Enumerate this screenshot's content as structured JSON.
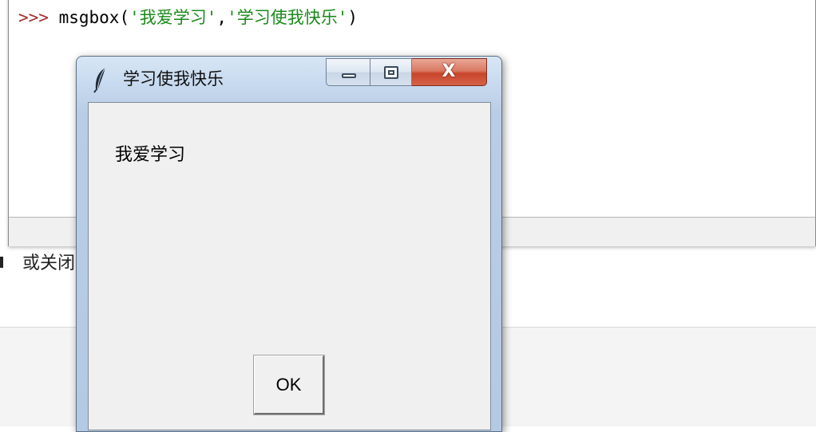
{
  "shell": {
    "prompt": ">>>",
    "function_name": "msgbox",
    "open_paren": "(",
    "arg1": "'我爱学习'",
    "comma": ",",
    "arg2": "'学习使我快乐'",
    "close_paren": ")",
    "partial_text": "或关闭"
  },
  "dialog": {
    "title": "学习使我快乐",
    "app_icon": "feather-icon",
    "minimize_icon": "minimize-icon",
    "maximize_icon": "maximize-icon",
    "close_icon": "close-icon",
    "close_glyph": "X",
    "message": "我爱学习",
    "ok_label": "OK"
  },
  "colors": {
    "prompt": "#a4302b",
    "string": "#1a8a1a",
    "close_button": "#c8452b",
    "titlebar": "#c5d8ee",
    "client": "#f0f0f0"
  }
}
